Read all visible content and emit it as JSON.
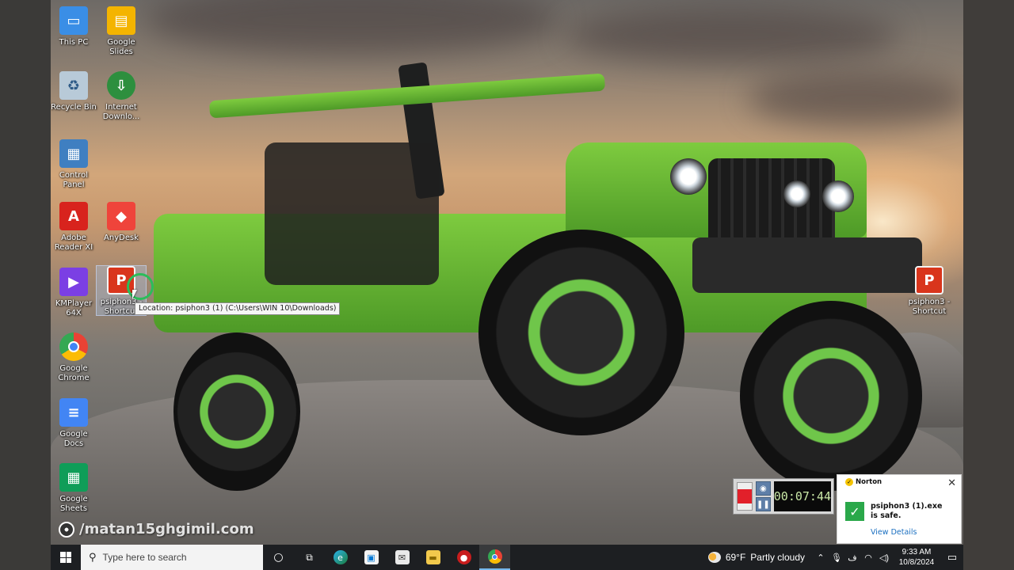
{
  "desktop_icons": [
    {
      "id": "this-pc",
      "label": "This PC",
      "color": "#3a8ee6"
    },
    {
      "id": "google-slides",
      "label": "Google Slides",
      "color": "#f4b400"
    },
    {
      "id": "recycle-bin",
      "label": "Recycle Bin",
      "color": "#9fb7cc"
    },
    {
      "id": "internet-download",
      "label": "Internet Downlo...",
      "color": "#2d8f3e"
    },
    {
      "id": "control-panel",
      "label": "Control Panel",
      "color": "#3f7fc1"
    },
    {
      "id": "adobe-reader",
      "label": "Adobe Reader XI",
      "color": "#d8231d"
    },
    {
      "id": "anydesk",
      "label": "AnyDesk",
      "color": "#ef443b"
    },
    {
      "id": "kmplayer",
      "label": "KMPlayer 64X",
      "color": "#7b3fe4"
    },
    {
      "id": "psiphon-left",
      "label": "psiphon3 - Shortcut",
      "color": "#d9351c"
    },
    {
      "id": "google-chrome",
      "label": "Google Chrome",
      "color": "#e94235"
    },
    {
      "id": "google-docs",
      "label": "Google Docs",
      "color": "#4285f4"
    },
    {
      "id": "google-sheets",
      "label": "Google Sheets",
      "color": "#0f9d58"
    },
    {
      "id": "psiphon-right",
      "label": "psiphon3 - Shortcut",
      "color": "#d9351c"
    }
  ],
  "tooltip": "Location: psiphon3 (1) (C:\\Users\\WIN 10\\Downloads)",
  "watermark": "/matan15ghgimil.com",
  "recorder": {
    "time": "00:07:44"
  },
  "norton": {
    "brand": "Norton",
    "message_line1": "psiphon3 (1).exe",
    "message_line2": "is safe.",
    "link": "View Details"
  },
  "taskbar": {
    "search_placeholder": "Type here to search",
    "weather_temp": "69°F",
    "weather_text": "Partly cloudy",
    "time": "9:33 AM",
    "date": "10/8/2024",
    "lang": "ف"
  }
}
